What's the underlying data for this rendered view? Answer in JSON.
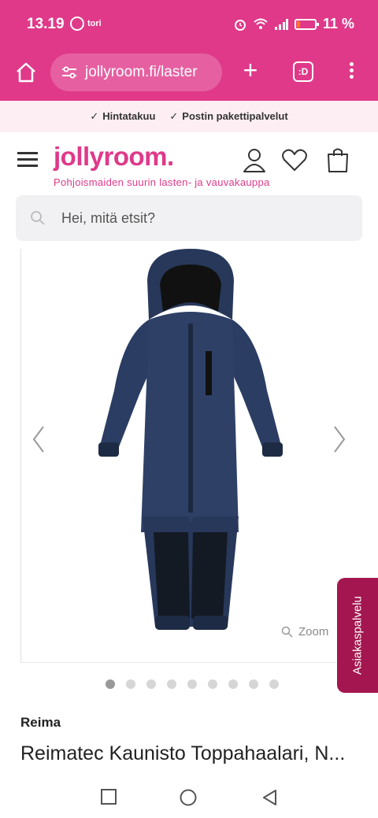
{
  "status": {
    "time": "13.19",
    "notif": "tori",
    "battery": "11 %"
  },
  "browser": {
    "url": "jollyroom.fi/laster",
    "tabs_label": ":D"
  },
  "promo": {
    "items": [
      "Hintatakuu",
      "Postin pakettipalvelut"
    ]
  },
  "header": {
    "logo": "jollyroom.",
    "tagline": "Pohjoismaiden suurin lasten- ja vauvakauppa"
  },
  "search": {
    "placeholder": "Hei, mitä etsit?"
  },
  "gallery": {
    "zoom_label": "Zoom",
    "image_count": 9,
    "active_index": 0
  },
  "support": {
    "label": "Asiakaspalvelu"
  },
  "product": {
    "brand": "Reima",
    "name": "Reimatec Kaunisto Toppahaalari, N..."
  },
  "colors": {
    "brand_pink": "#e0398a",
    "support_bg": "#a3164f",
    "suit_navy": "#27385a"
  }
}
